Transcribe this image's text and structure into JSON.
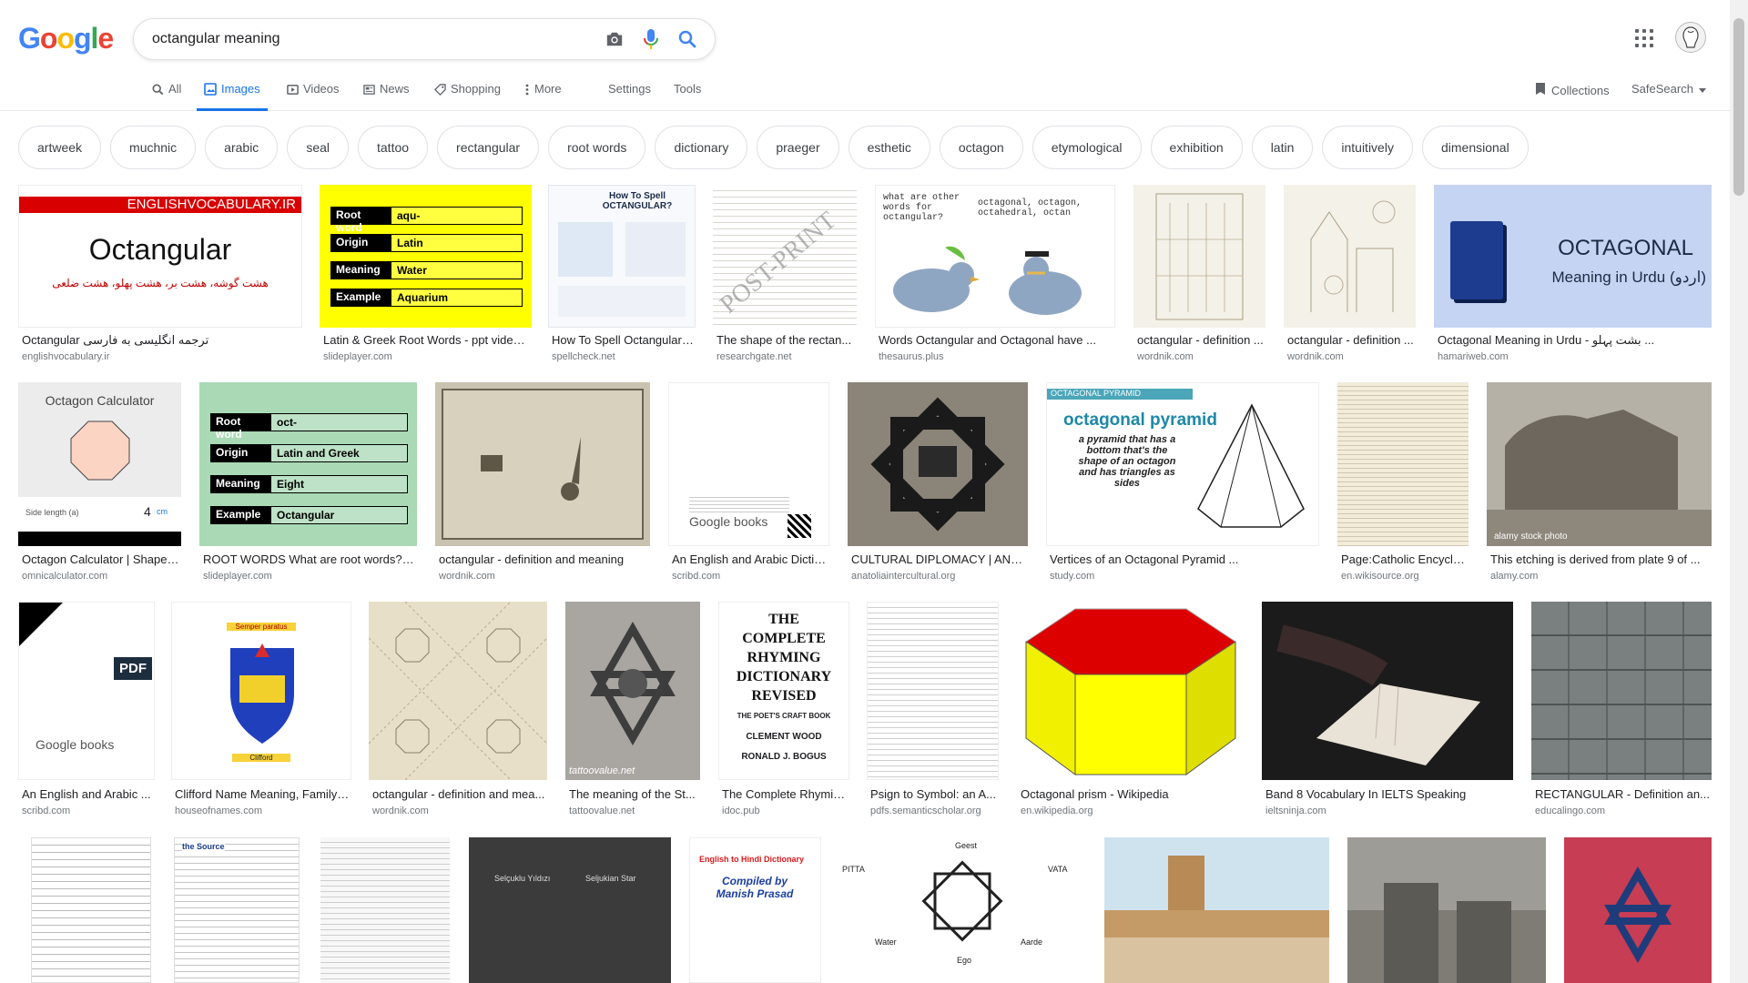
{
  "logo": {
    "letters": [
      "G",
      "o",
      "o",
      "g",
      "l",
      "e"
    ]
  },
  "search": {
    "query": "octangular meaning"
  },
  "tabs": [
    {
      "label": "All",
      "icon": "search-icon",
      "active": false
    },
    {
      "label": "Images",
      "icon": "image-icon",
      "active": true
    },
    {
      "label": "Videos",
      "icon": "video-icon",
      "active": false
    },
    {
      "label": "News",
      "icon": "news-icon",
      "active": false
    },
    {
      "label": "Shopping",
      "icon": "tag-icon",
      "active": false
    },
    {
      "label": "More",
      "icon": "more-vert-icon",
      "active": false
    }
  ],
  "tools": {
    "settings": "Settings",
    "tools": "Tools",
    "collections": "Collections",
    "safesearch": "SafeSearch"
  },
  "chips": [
    "artweek",
    "muchnic",
    "arabic",
    "seal",
    "tattoo",
    "rectangular",
    "root words",
    "dictionary",
    "praeger",
    "esthetic",
    "octagon",
    "etymological",
    "exhibition",
    "latin",
    "intuitively",
    "dimensional"
  ],
  "results": [
    {
      "title": "Octangular ترجمه انگلیسی به فارسی",
      "source": "englishvocabulary.ir",
      "overlay": [
        "ENGLISHVOCABULARY.IR",
        "Octangular",
        "هشت گوشه، هشت بر، هشت پهلو، هشت ضلعی"
      ]
    },
    {
      "title": "Latin & Greek Root Words - ppt video ...",
      "source": "slideplayer.com",
      "rows": [
        [
          "Root word",
          "aqu-"
        ],
        [
          "Origin",
          "Latin"
        ],
        [
          "Meaning",
          "Water"
        ],
        [
          "Example",
          "Aquarium"
        ]
      ]
    },
    {
      "title": "How To Spell Octangular ...",
      "source": "spellcheck.net",
      "overlay": [
        "How To Spell OCTANGULAR?"
      ]
    },
    {
      "title": "The shape of the rectan...",
      "source": "researchgate.net",
      "overlay": [
        "POST-PRINT"
      ]
    },
    {
      "title": "Words Octangular and Octagonal have ...",
      "source": "thesaurus.plus",
      "overlay": [
        "what are other words for octangular?",
        "octagonal, octagon, octahedral, octan"
      ]
    },
    {
      "title": "octangular - definition ...",
      "source": "wordnik.com"
    },
    {
      "title": "octangular - definition ...",
      "source": "wordnik.com"
    },
    {
      "title": "Octagonal Meaning in Urdu - بشت پہلو ...",
      "source": "hamariweb.com",
      "overlay": [
        "OCTAGONAL",
        "Meaning in Urdu (اردو)"
      ]
    },
    {
      "title": "Octagon Calculator | Shape ...",
      "source": "omnicalculator.com",
      "overlay": [
        "Octagon Calculator",
        "Side length (a)",
        "4",
        "cm"
      ]
    },
    {
      "title": "ROOT WORDS What are root words? ...",
      "source": "slideplayer.com",
      "rows": [
        [
          "Root word",
          "oct-"
        ],
        [
          "Origin",
          "Latin and Greek"
        ],
        [
          "Meaning",
          "Eight"
        ],
        [
          "Example",
          "Octangular"
        ]
      ]
    },
    {
      "title": "octangular - definition and meaning",
      "source": "wordnik.com"
    },
    {
      "title": "An English and Arabic Dictio...",
      "source": "scribd.com",
      "overlay": [
        "Google books"
      ]
    },
    {
      "title": "CULTURAL DIPLOMACY | ANA...",
      "source": "anatoliaintercultural.org"
    },
    {
      "title": "Vertices of an Octagonal Pyramid ...",
      "source": "study.com",
      "overlay": [
        "OCTAGONAL PYRAMID",
        "octagonal pyramid",
        "a pyramid that has a bottom that's the shape of an octagon and has triangles as sides"
      ]
    },
    {
      "title": "Page:Catholic Encyclo...",
      "source": "en.wikisource.org"
    },
    {
      "title": "This etching is derived from plate 9 of ...",
      "source": "alamy.com",
      "overlay": [
        "alamy stock photo"
      ]
    },
    {
      "title": "An English and Arabic ...",
      "source": "scribd.com",
      "overlay": [
        "PDF",
        "Google books"
      ]
    },
    {
      "title": "Clifford Name Meaning, Family ...",
      "source": "houseofnames.com",
      "overlay": [
        "Semper paratus",
        "Clifford"
      ]
    },
    {
      "title": "octangular - definition and mea...",
      "source": "wordnik.com"
    },
    {
      "title": "The meaning of the St...",
      "source": "tattoovalue.net",
      "overlay": [
        "tattoovalue.net"
      ]
    },
    {
      "title": "The Complete Rhymin...",
      "source": "idoc.pub",
      "overlay": [
        "THE COMPLETE RHYMING DICTIONARY REVISED",
        "THE POET'S CRAFT BOOK",
        "CLEMENT WOOD",
        "RONALD J. BOGUS"
      ]
    },
    {
      "title": "Psign to Symbol: an A...",
      "source": "pdfs.semanticscholar.org"
    },
    {
      "title": "Octagonal prism - Wikipedia",
      "source": "en.wikipedia.org"
    },
    {
      "title": "Band 8 Vocabulary In IELTS Speaking",
      "source": "ieltsninja.com"
    },
    {
      "title": "RECTANGULAR - Definition an...",
      "source": "educalingo.com"
    },
    {
      "title": "",
      "source": ""
    },
    {
      "title": "",
      "source": "",
      "overlay": [
        "the Source"
      ]
    },
    {
      "title": "",
      "source": ""
    },
    {
      "title": "",
      "source": "",
      "overlay": [
        "Selçuklu Yıldızı",
        "Seljukian Star"
      ]
    },
    {
      "title": "",
      "source": "",
      "overlay": [
        "English to Hindi Dictionary",
        "Compiled by Manish Prasad"
      ]
    },
    {
      "title": "",
      "source": "",
      "overlay": [
        "Geest",
        "PITTA",
        "VATA",
        "Ego",
        "Water",
        "Aarde"
      ]
    },
    {
      "title": "",
      "source": ""
    },
    {
      "title": "",
      "source": ""
    },
    {
      "title": "",
      "source": ""
    }
  ],
  "colors": {
    "accent": "#1a73e8",
    "chip_border": "#dfe1e5",
    "source_gray": "#70757a"
  }
}
